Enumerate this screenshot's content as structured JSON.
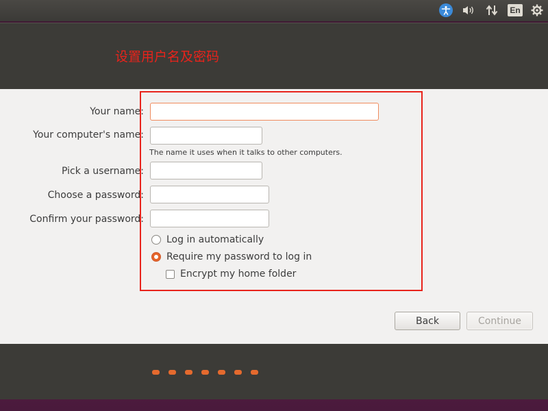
{
  "tray": {
    "icons": [
      "accessibility-icon",
      "volume-icon",
      "network-icon",
      "keyboard-layout-icon",
      "settings-gear-icon"
    ],
    "language": "En",
    "accent_color": "#3b8ad8"
  },
  "header": {
    "title": "设置用户名及密码",
    "title_color": "#e8231b"
  },
  "form": {
    "your_name": {
      "label": "Your name:",
      "value": "",
      "placeholder": ""
    },
    "computer_name": {
      "label": "Your computer's name:",
      "value": "",
      "hint": "The name it uses when it talks to other computers."
    },
    "username": {
      "label": "Pick a username:",
      "value": ""
    },
    "password": {
      "label": "Choose a password:",
      "value": ""
    },
    "confirm_password": {
      "label": "Confirm your password:",
      "value": ""
    },
    "options": {
      "login_auto": {
        "label": "Log in automatically",
        "selected": false
      },
      "require_password": {
        "label": "Require my password to log in",
        "selected": true
      },
      "encrypt_home": {
        "label": "Encrypt my home folder",
        "checked": false
      }
    }
  },
  "buttons": {
    "back": "Back",
    "continue": "Continue"
  },
  "progress": {
    "dots": 7,
    "dot_color": "#e56a2e"
  }
}
